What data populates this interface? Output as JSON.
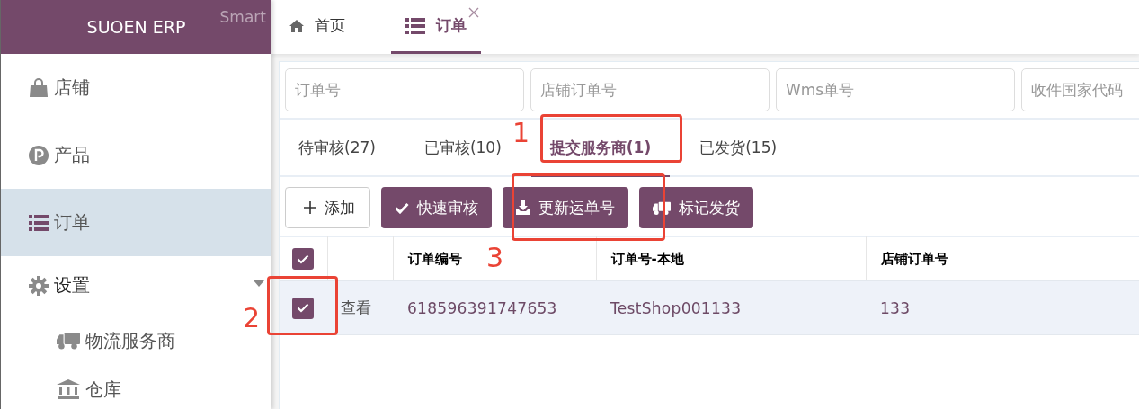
{
  "sidebar": {
    "brand": "SUOEN ERP",
    "badge": "Smart",
    "items": [
      {
        "label": "店铺",
        "selected": false
      },
      {
        "label": "产品",
        "selected": false
      },
      {
        "label": "订单",
        "selected": true
      },
      {
        "label": "设置",
        "selected": false,
        "expanded": true,
        "children": [
          {
            "label": "物流服务商",
            "selected": false
          },
          {
            "label": "仓库",
            "selected": false
          }
        ]
      }
    ]
  },
  "page_tabs": [
    {
      "label": "首页",
      "selected": false,
      "closable": false
    },
    {
      "label": "订单",
      "selected": true,
      "closable": true
    }
  ],
  "filters": [
    {
      "placeholder": "订单号"
    },
    {
      "placeholder": "店铺订单号"
    },
    {
      "placeholder": "Wms单号"
    },
    {
      "placeholder": "收件国家代码"
    }
  ],
  "status_tabs": [
    {
      "label": "待审核(27)",
      "selected": false
    },
    {
      "label": "已审核(10)",
      "selected": false
    },
    {
      "label": "提交服务商(1)",
      "selected": true
    },
    {
      "label": "已发货(15)",
      "selected": false
    }
  ],
  "toolbar": [
    {
      "label": "添加",
      "kind": "outline"
    },
    {
      "label": "快速审核",
      "kind": "primary"
    },
    {
      "label": "更新运单号",
      "kind": "primary"
    },
    {
      "label": "标记发货",
      "kind": "primary"
    }
  ],
  "table": {
    "select_all": {
      "checked": true
    },
    "columns": [
      "订单编号",
      "订单号-本地",
      "店铺订单号"
    ],
    "rows": [
      {
        "checked": true,
        "action": "查看",
        "cells": [
          "618596391747653",
          "TestShop001133",
          "133"
        ]
      }
    ]
  },
  "annotations": [
    {
      "label": "1"
    },
    {
      "label": "2"
    },
    {
      "label": "3"
    }
  ]
}
